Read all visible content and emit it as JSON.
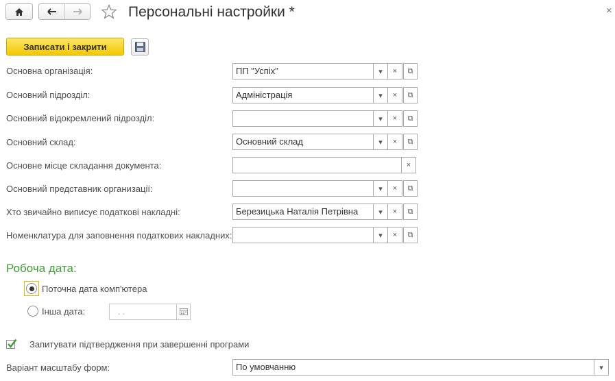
{
  "header": {
    "title": "Персональні настройки *",
    "close_glyph": "×"
  },
  "toolbar": {
    "save_close_label": "Записати і закрити"
  },
  "fields": [
    {
      "label": "Основна організація:",
      "value": "ПП \"Успіх\"",
      "type": "select"
    },
    {
      "label": "Основний підрозділ:",
      "value": "Адміністрація",
      "type": "select"
    },
    {
      "label": "Основний відокремлений підрозділ:",
      "value": "",
      "type": "select"
    },
    {
      "label": "Основний склад:",
      "value": "Основний склад",
      "type": "select"
    },
    {
      "label": "Основне місце складання документа:",
      "value": "",
      "type": "text-clear"
    },
    {
      "label": "Основний представник организації:",
      "value": "",
      "type": "select"
    },
    {
      "label": "Хто звичайно виписує податкові накладні:",
      "value": "Березицька Наталія Петрівна",
      "type": "select"
    },
    {
      "label": "Номенклатура для заповнення податкових накладних:",
      "value": "",
      "type": "select"
    }
  ],
  "working_date": {
    "section_title": "Робоча дата:",
    "options": [
      {
        "label": "Поточна дата комп'ютера",
        "selected": true
      },
      {
        "label": "Інша дата:",
        "selected": false
      }
    ],
    "date_placeholder": " .  .    "
  },
  "confirm_exit": {
    "label": "Запитувати підтвердження при завершенні програми",
    "checked": true
  },
  "scale": {
    "label": "Варіант масштабу форм:",
    "value": "По умовчанню"
  },
  "colors": {
    "accent_yellow": "#f4c800",
    "section_green": "#3d9b35",
    "check_green": "#3d9b35"
  }
}
